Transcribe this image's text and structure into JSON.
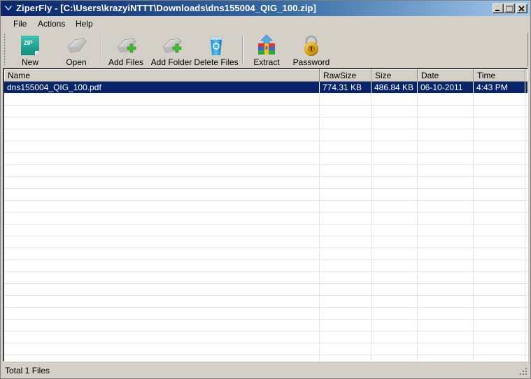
{
  "window": {
    "title": "ZiperFly - [C:\\Users\\krazyiNTTT\\Downloads\\dns155004_QIG_100.zip]",
    "controls": {
      "minimize": "minimize",
      "maximize": "maximize",
      "close": "close"
    }
  },
  "menu": {
    "items": [
      {
        "label": "File"
      },
      {
        "label": "Actions"
      },
      {
        "label": "Help"
      }
    ]
  },
  "toolbar": {
    "buttons": [
      {
        "label": "New",
        "icon": "zip-new-icon",
        "icon_text": "ZIP"
      },
      {
        "label": "Open",
        "icon": "folder-open-icon"
      },
      {
        "label": "Add Files",
        "icon": "add-files-icon"
      },
      {
        "label": "Add Folder",
        "icon": "add-folder-icon"
      },
      {
        "label": "Delete Files",
        "icon": "recycle-bin-icon"
      },
      {
        "label": "Extract",
        "icon": "extract-archive-icon"
      },
      {
        "label": "Password",
        "icon": "padlock-icon"
      }
    ]
  },
  "filelist": {
    "columns": [
      {
        "label": "Name"
      },
      {
        "label": "RawSize"
      },
      {
        "label": "Size"
      },
      {
        "label": "Date"
      },
      {
        "label": "Time"
      }
    ],
    "rows": [
      {
        "name": "dns155004_QIG_100.pdf",
        "rawsize": "774.31 KB",
        "size": "486.84 KB",
        "date": "06-10-2011",
        "time": "4:43 PM",
        "selected": true
      }
    ]
  },
  "statusbar": {
    "text": "Total 1 Files"
  },
  "colors": {
    "selection": "#0a246a",
    "titlebar_start": "#0a246a",
    "titlebar_end": "#a6caf0",
    "face": "#d4d0c8"
  }
}
